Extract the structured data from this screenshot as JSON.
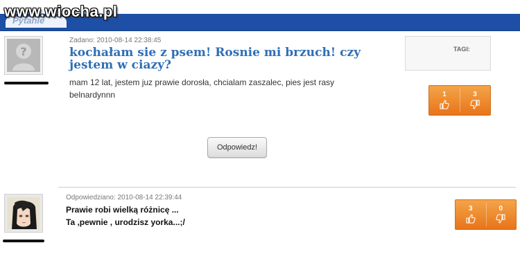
{
  "watermark": "www.wiocha.pl",
  "section_bar": {
    "title": "Pytanie"
  },
  "question": {
    "meta": "Zadano: 2010-08-14 22:38:45",
    "title": "kochałam sie z psem! Rosnie mi brzuch! czy jestem w ciazy?",
    "body": "mam 12 lat, jestem juz prawie dorosła, chcialam zaszalec, pies jest rasy belnardynnn",
    "tags_label": "TAGI:",
    "votes": {
      "up": "1",
      "down": "3"
    },
    "reply_button": "Odpowiedz!"
  },
  "answer": {
    "meta": "Odpowiedziano: 2010-08-14 22:39:44",
    "line1": "Prawie robi wielką różnicę ...",
    "line2": "Ta ,pewnie , urodzisz yorka...;/",
    "votes": {
      "up": "3",
      "down": "0"
    }
  },
  "icons": {
    "avatar_placeholder": "question-mark-avatar-icon",
    "thumbs_up": "thumbs-up-icon",
    "thumbs_down": "thumbs-down-icon"
  },
  "colors": {
    "bar": "#1c4fa5",
    "title_link": "#2f6fb5",
    "vote_orange": "#ec7e22"
  }
}
